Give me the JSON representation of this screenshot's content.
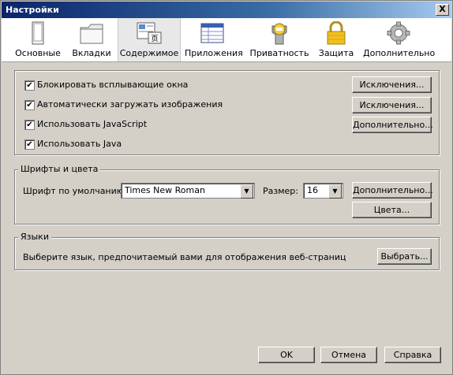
{
  "window": {
    "title": "Настройки",
    "close_label": "X"
  },
  "toolbar": {
    "items": [
      {
        "label": "Основные",
        "icon": "general-icon"
      },
      {
        "label": "Вкладки",
        "icon": "tabs-icon"
      },
      {
        "label": "Содержимое",
        "icon": "content-icon",
        "selected": true
      },
      {
        "label": "Приложения",
        "icon": "applications-icon"
      },
      {
        "label": "Приватность",
        "icon": "privacy-icon"
      },
      {
        "label": "Защита",
        "icon": "security-lock-icon"
      },
      {
        "label": "Дополнительно",
        "icon": "advanced-gear-icon"
      }
    ]
  },
  "content": {
    "options": [
      {
        "label": "Блокировать всплывающие окна",
        "checked": true,
        "button": "Исключения..."
      },
      {
        "label": "Автоматически загружать изображения",
        "checked": true,
        "button": "Исключения..."
      },
      {
        "label": "Использовать JavaScript",
        "checked": true,
        "button": "Дополнительно..."
      },
      {
        "label": "Использовать Java",
        "checked": true
      }
    ]
  },
  "fonts": {
    "group_title": "Шрифты и цвета",
    "default_font_label": "Шрифт по умолчанию:",
    "default_font_value": "Times New Roman",
    "size_label": "Размер:",
    "size_value": "16",
    "advanced_button": "Дополнительно...",
    "colors_button": "Цвета..."
  },
  "languages": {
    "group_title": "Языки",
    "description": "Выберите язык, предпочитаемый вами для отображения веб-страниц",
    "choose_button": "Выбрать..."
  },
  "footer": {
    "ok": "OK",
    "cancel": "Отмена",
    "help": "Справка"
  },
  "colors": {
    "titlebar": "#0a246a",
    "dialog_bg": "#d4d0c8",
    "toolbar_bg": "#ffffff",
    "lock": "#f0c020"
  }
}
